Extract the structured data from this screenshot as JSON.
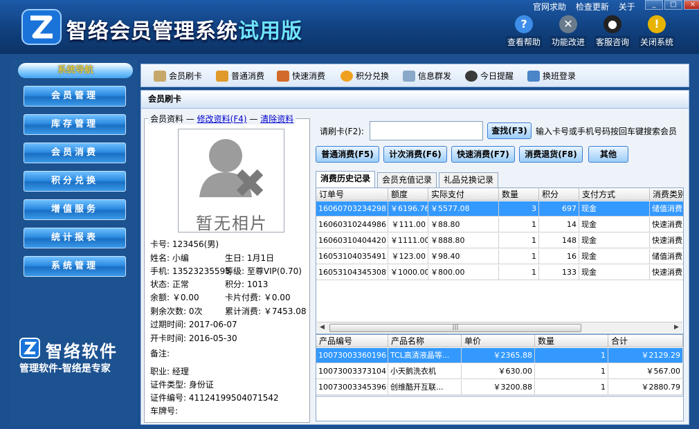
{
  "title": {
    "main": "智络会员管理系统",
    "edition": "试用版"
  },
  "top_links": [
    "官网求助",
    "检查更新",
    "关于"
  ],
  "top_buttons": [
    {
      "label": "查看帮助",
      "icon": "question-icon",
      "color": "#3d8ee8"
    },
    {
      "label": "功能改进",
      "icon": "tools-icon",
      "color": "#6a7b8c"
    },
    {
      "label": "客服咨询",
      "icon": "penguin-icon",
      "color": "#222222"
    },
    {
      "label": "关闭系统",
      "icon": "warning-icon",
      "color": "#e6b400"
    }
  ],
  "nav": {
    "header": "系统导航",
    "items": [
      "会员管理",
      "库存管理",
      "会员消费",
      "积分兑换",
      "增值服务",
      "统计报表",
      "系统管理"
    ]
  },
  "brand": {
    "name": "智络软件",
    "slogan": "管理软件-智络是专家"
  },
  "toolbar": [
    "会员刷卡",
    "普通消费",
    "快速消费",
    "积分兑换",
    "信息群发",
    "今日提醒",
    "换班登录"
  ],
  "panel_title": "会员刷卡",
  "profile": {
    "legend": "会员资料",
    "edit_link": "修改资料(F4)",
    "clear_link": "清除资料",
    "photo_text": "暂无相片",
    "card": "卡号: 123456(男)",
    "name": "姓名: 小编",
    "birthday": "生日: 1月1日",
    "phone": "手机: 13523235595",
    "level": "等级: 至尊VIP(0.70)",
    "status": "状态: 正常",
    "points": "积分: 1013",
    "balance": "余额: ￥0.00",
    "card_fee": "卡片付费: ￥0.00",
    "remaining": "剩余次数: 0次",
    "total": "累计消费: ￥7453.08",
    "expire": "过期时间: 2017-06-07",
    "open_date": "开卡时间: 2016-05-30",
    "remark": "备注:",
    "job": "职业: 经理",
    "id_type": "证件类型: 身份证",
    "id_no": "证件编号: 41124199504071542",
    "plate": "车牌号:"
  },
  "search": {
    "label": "请刷卡(F2):",
    "value": "",
    "button": "查找(F3)",
    "hint": "输入卡号或手机号码按回车键搜索会员"
  },
  "actions": [
    "普通消费(F5)",
    "计次消费(F6)",
    "快速消费(F7)",
    "消费退货(F8)",
    "其他"
  ],
  "tabs": [
    "消费历史记录",
    "会员充值记录",
    "礼品兑换记录"
  ],
  "history": {
    "headers": [
      "订单号",
      "额度",
      "实际支付",
      "数量",
      "积分",
      "支付方式",
      "消费类别"
    ],
    "rows": [
      [
        "16060703234298",
        "￥6196.76",
        "￥5577.08",
        "3",
        "697",
        "现金",
        "储值消费"
      ],
      [
        "16060310244986",
        "￥111.00",
        "￥88.80",
        "1",
        "14",
        "现金",
        "快速消费"
      ],
      [
        "16060310404420",
        "￥1111.00",
        "￥888.80",
        "1",
        "148",
        "现金",
        "快速消费"
      ],
      [
        "16053104035491",
        "￥123.00",
        "￥98.40",
        "1",
        "16",
        "现金",
        "储值消费"
      ],
      [
        "16053104345308",
        "￥1000.00",
        "￥800.00",
        "1",
        "133",
        "现金",
        "快速消费"
      ]
    ]
  },
  "products": {
    "headers": [
      "产品编号",
      "产品名称",
      "单价",
      "数量",
      "合计"
    ],
    "rows": [
      [
        "10073003360196",
        "TCL高清液晶等...",
        "￥2365.88",
        "1",
        "￥2129.29"
      ],
      [
        "10073003373104",
        "小天鹅洗衣机",
        "￥630.00",
        "1",
        "￥567.00"
      ],
      [
        "10073003345396",
        "创维酷开互联...",
        "￥3200.88",
        "1",
        "￥2880.79"
      ]
    ]
  }
}
